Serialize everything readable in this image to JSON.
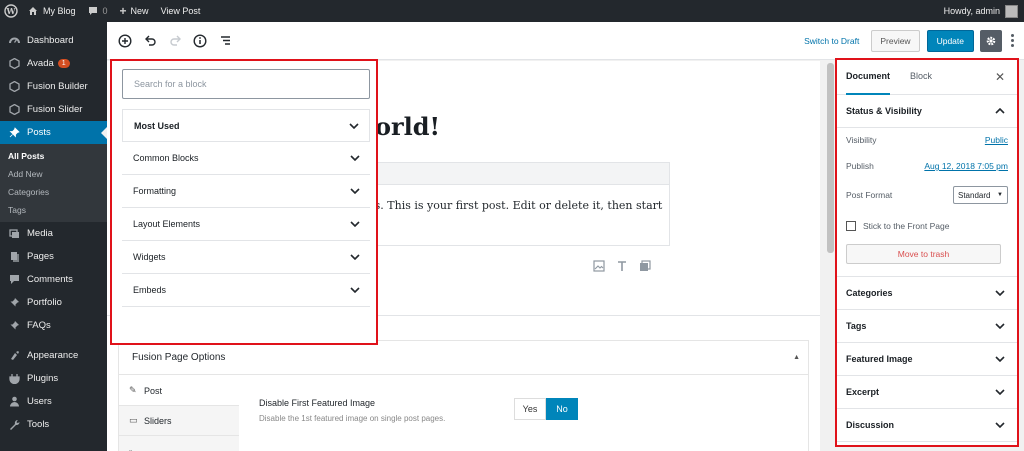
{
  "adminbar": {
    "site_name": "My Blog",
    "comments_count": "0",
    "new_label": "New",
    "view_post_label": "View Post",
    "howdy": "Howdy, admin"
  },
  "sidebar": {
    "items": [
      {
        "label": "Dashboard",
        "icon": "dashboard-icon"
      },
      {
        "label": "Avada",
        "icon": "avada-icon",
        "badge": "1"
      },
      {
        "label": "Fusion Builder",
        "icon": "fusion-builder-icon"
      },
      {
        "label": "Fusion Slider",
        "icon": "fusion-slider-icon"
      },
      {
        "label": "Posts",
        "icon": "pin-icon"
      }
    ],
    "posts_submenu": [
      "All Posts",
      "Add New",
      "Categories",
      "Tags"
    ],
    "items_after": [
      {
        "label": "Media",
        "icon": "media-icon"
      },
      {
        "label": "Pages",
        "icon": "pages-icon"
      },
      {
        "label": "Comments",
        "icon": "comments-icon"
      },
      {
        "label": "Portfolio",
        "icon": "portfolio-icon"
      },
      {
        "label": "FAQs",
        "icon": "faq-icon"
      },
      {
        "label": "Appearance",
        "icon": "appearance-icon"
      },
      {
        "label": "Plugins",
        "icon": "plugins-icon"
      },
      {
        "label": "Users",
        "icon": "users-icon"
      },
      {
        "label": "Tools",
        "icon": "tools-icon"
      }
    ]
  },
  "toolbar": {
    "switch_draft": "Switch to Draft",
    "preview": "Preview",
    "update": "Update"
  },
  "post": {
    "title_visible": "orld!",
    "content_visible": "ss. This is your first post. Edit or delete it, then start"
  },
  "inserter": {
    "search_placeholder": "Search for a block",
    "categories": [
      "Most Used",
      "Common Blocks",
      "Formatting",
      "Layout Elements",
      "Widgets",
      "Embeds"
    ]
  },
  "fusion": {
    "title": "Fusion Page Options",
    "tabs": [
      "Post",
      "Sliders"
    ],
    "field_label": "Disable First Featured Image",
    "field_desc": "Disable the 1st featured image on single post pages.",
    "yes": "Yes",
    "no": "No",
    "selected": "No"
  },
  "settings": {
    "tab_document": "Document",
    "tab_block": "Block",
    "status_visibility": "Status & Visibility",
    "visibility_label": "Visibility",
    "visibility_value": "Public",
    "publish_label": "Publish",
    "publish_value": "Aug 12, 2018 7:05 pm",
    "post_format_label": "Post Format",
    "post_format_value": "Standard",
    "stick_label": "Stick to the Front Page",
    "trash_label": "Move to trash",
    "panels": [
      "Categories",
      "Tags",
      "Featured Image",
      "Excerpt",
      "Discussion"
    ]
  },
  "colors": {
    "admin_bar": "#23282d",
    "accent": "#0073aa",
    "update_button": "#0085ba",
    "highlight_border": "#e0121a"
  }
}
